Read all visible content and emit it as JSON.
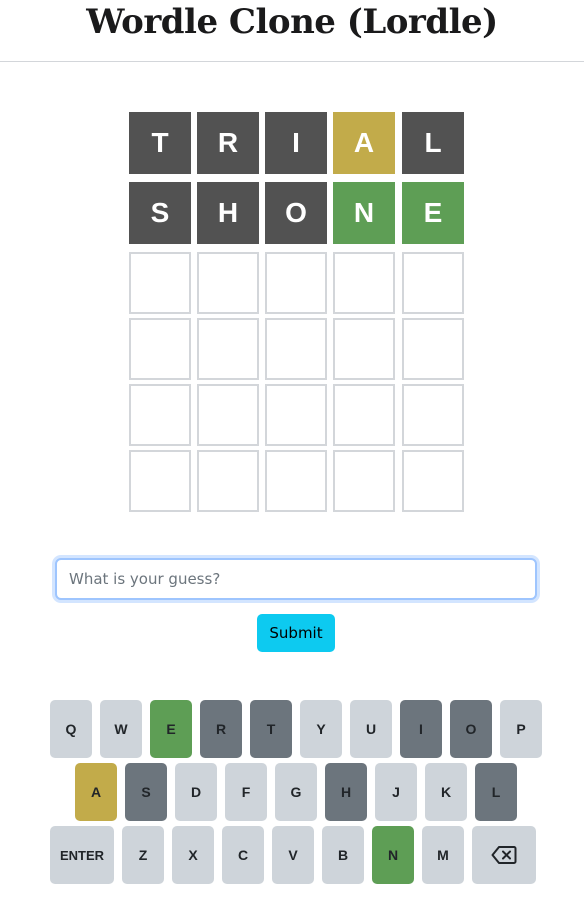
{
  "app": {
    "title": "Wordle Clone (Lordle)"
  },
  "colors": {
    "absent_tile": "#525252",
    "present": "#c2ab4a",
    "correct": "#5e9e55",
    "key_default": "#ced4da",
    "key_absent": "#6c757d",
    "submit": "#0dcaf0"
  },
  "board": {
    "rows": [
      [
        {
          "letter": "T",
          "state": "absent"
        },
        {
          "letter": "R",
          "state": "absent"
        },
        {
          "letter": "I",
          "state": "absent"
        },
        {
          "letter": "A",
          "state": "present"
        },
        {
          "letter": "L",
          "state": "absent"
        }
      ],
      [
        {
          "letter": "S",
          "state": "absent"
        },
        {
          "letter": "H",
          "state": "absent"
        },
        {
          "letter": "O",
          "state": "absent"
        },
        {
          "letter": "N",
          "state": "correct"
        },
        {
          "letter": "E",
          "state": "correct"
        }
      ],
      [
        {
          "letter": "",
          "state": "empty"
        },
        {
          "letter": "",
          "state": "empty"
        },
        {
          "letter": "",
          "state": "empty"
        },
        {
          "letter": "",
          "state": "empty"
        },
        {
          "letter": "",
          "state": "empty"
        }
      ],
      [
        {
          "letter": "",
          "state": "empty"
        },
        {
          "letter": "",
          "state": "empty"
        },
        {
          "letter": "",
          "state": "empty"
        },
        {
          "letter": "",
          "state": "empty"
        },
        {
          "letter": "",
          "state": "empty"
        }
      ],
      [
        {
          "letter": "",
          "state": "empty"
        },
        {
          "letter": "",
          "state": "empty"
        },
        {
          "letter": "",
          "state": "empty"
        },
        {
          "letter": "",
          "state": "empty"
        },
        {
          "letter": "",
          "state": "empty"
        }
      ],
      [
        {
          "letter": "",
          "state": "empty"
        },
        {
          "letter": "",
          "state": "empty"
        },
        {
          "letter": "",
          "state": "empty"
        },
        {
          "letter": "",
          "state": "empty"
        },
        {
          "letter": "",
          "state": "empty"
        }
      ]
    ]
  },
  "guess": {
    "value": "",
    "placeholder": "What is your guess?",
    "submit_label": "Submit"
  },
  "keyboard": {
    "rows": [
      [
        {
          "label": "Q",
          "state": "default"
        },
        {
          "label": "W",
          "state": "default"
        },
        {
          "label": "E",
          "state": "correct"
        },
        {
          "label": "R",
          "state": "absent"
        },
        {
          "label": "T",
          "state": "absent"
        },
        {
          "label": "Y",
          "state": "default"
        },
        {
          "label": "U",
          "state": "default"
        },
        {
          "label": "I",
          "state": "absent"
        },
        {
          "label": "O",
          "state": "absent"
        },
        {
          "label": "P",
          "state": "default"
        }
      ],
      [
        {
          "label": "A",
          "state": "present"
        },
        {
          "label": "S",
          "state": "absent"
        },
        {
          "label": "D",
          "state": "default"
        },
        {
          "label": "F",
          "state": "default"
        },
        {
          "label": "G",
          "state": "default"
        },
        {
          "label": "H",
          "state": "absent"
        },
        {
          "label": "J",
          "state": "default"
        },
        {
          "label": "K",
          "state": "default"
        },
        {
          "label": "L",
          "state": "absent"
        }
      ],
      [
        {
          "label": "ENTER",
          "state": "default",
          "kind": "enter"
        },
        {
          "label": "Z",
          "state": "default"
        },
        {
          "label": "X",
          "state": "default"
        },
        {
          "label": "C",
          "state": "default"
        },
        {
          "label": "V",
          "state": "default"
        },
        {
          "label": "B",
          "state": "default"
        },
        {
          "label": "N",
          "state": "correct"
        },
        {
          "label": "M",
          "state": "default"
        },
        {
          "label": "",
          "state": "default",
          "kind": "backspace",
          "icon": "backspace-icon"
        }
      ]
    ]
  }
}
